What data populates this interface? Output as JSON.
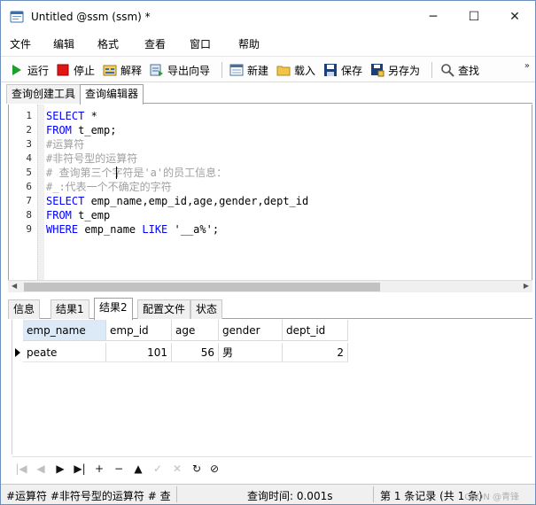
{
  "window": {
    "title": "Untitled @ssm (ssm) *",
    "minimize_glyph": "─",
    "maximize_glyph": "☐",
    "close_glyph": "✕"
  },
  "menu": [
    "文件",
    "编辑",
    "格式",
    "查看",
    "窗口",
    "帮助"
  ],
  "toolbar": {
    "run": "运行",
    "stop": "停止",
    "explain": "解释",
    "export_wizard": "导出向导",
    "new": "新建",
    "load": "载入",
    "save": "保存",
    "save_as": "另存为",
    "find": "查找",
    "more": "»"
  },
  "top_tabs": [
    "查询创建工具",
    "查询编辑器"
  ],
  "editor": {
    "lines": [
      {
        "n": "1",
        "parts": [
          [
            "kw",
            "SELECT"
          ],
          [
            "st",
            " *"
          ]
        ]
      },
      {
        "n": "2",
        "parts": [
          [
            "kw",
            "FROM"
          ],
          [
            "st",
            " t_emp;"
          ]
        ]
      },
      {
        "n": "3",
        "parts": [
          [
            "cm",
            "#运算符"
          ]
        ]
      },
      {
        "n": "4",
        "parts": [
          [
            "cm",
            "#非符号型的运算符"
          ]
        ]
      },
      {
        "n": "5",
        "parts": [
          [
            "cm",
            "# 查询第三个字符是'a'的员工信息："
          ]
        ]
      },
      {
        "n": "6",
        "parts": [
          [
            "cm",
            "#_:代表一个不确定的字符"
          ]
        ]
      },
      {
        "n": "7",
        "parts": [
          [
            "kw",
            "SELECT"
          ],
          [
            "st",
            " emp_name,emp_id,age,gender,dept_id"
          ]
        ]
      },
      {
        "n": "8",
        "parts": [
          [
            "kw",
            "FROM"
          ],
          [
            "st",
            " t_emp"
          ]
        ]
      },
      {
        "n": "9",
        "parts": [
          [
            "kw",
            "WHERE"
          ],
          [
            "st",
            " emp_name "
          ],
          [
            "kw",
            "LIKE"
          ],
          [
            "st",
            " '__a%';"
          ]
        ]
      }
    ]
  },
  "result_tabs": [
    "信息",
    "结果1",
    "结果2",
    "配置文件",
    "状态"
  ],
  "grid": {
    "columns": [
      "emp_name",
      "emp_id",
      "age",
      "gender",
      "dept_id"
    ],
    "rows": [
      [
        "peate",
        "101",
        "56",
        "男",
        "2"
      ]
    ]
  },
  "gridnav": [
    "|◀",
    "◀",
    "▶",
    "▶|",
    "+",
    "−",
    "▲",
    "✓",
    "✕",
    "↻",
    "⊘"
  ],
  "status": {
    "left": "#运算符 #非符号型的运算符 # 查",
    "time": "查询时间: 0.001s",
    "records": "第 1 条记录 (共 1 条)",
    "watermark": "CSDN @青锋"
  }
}
